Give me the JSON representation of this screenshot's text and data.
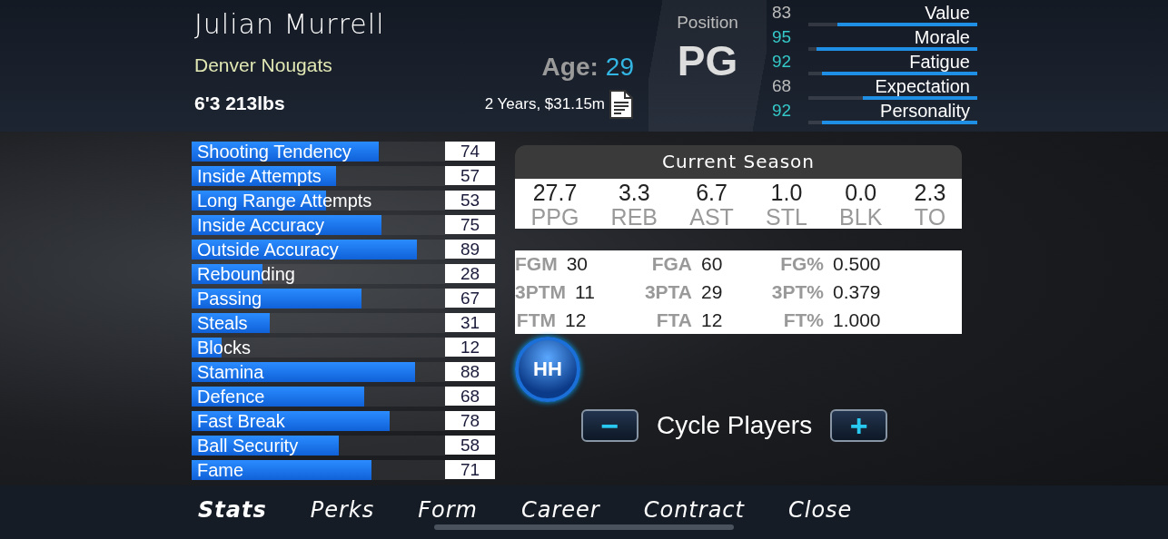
{
  "player": {
    "name": "Julian Murrell",
    "team": "Denver Nougats",
    "body": "6'3  213lbs",
    "age_label": "Age:",
    "age": "29",
    "contract": "2 Years, $31.15m",
    "position_label": "Position",
    "position": "PG"
  },
  "meters": [
    {
      "value": "83",
      "label": "Value",
      "level": 0.83,
      "highlight": false
    },
    {
      "value": "95",
      "label": "Morale",
      "level": 0.95,
      "highlight": true
    },
    {
      "value": "92",
      "label": "Fatigue",
      "level": 0.92,
      "highlight": true
    },
    {
      "value": "68",
      "label": "Expectation",
      "level": 0.68,
      "highlight": false
    },
    {
      "value": "92",
      "label": "Personality",
      "level": 0.92,
      "highlight": true
    }
  ],
  "attributes": [
    {
      "label": "Shooting Tendency",
      "value": "74",
      "level": 0.74
    },
    {
      "label": "Inside Attempts",
      "value": "57",
      "level": 0.57
    },
    {
      "label": "Long Range Attempts",
      "value": "53",
      "level": 0.53
    },
    {
      "label": "Inside Accuracy",
      "value": "75",
      "level": 0.75
    },
    {
      "label": "Outside Accuracy",
      "value": "89",
      "level": 0.89
    },
    {
      "label": "Rebounding",
      "value": "28",
      "level": 0.28
    },
    {
      "label": "Passing",
      "value": "67",
      "level": 0.67
    },
    {
      "label": "Steals",
      "value": "31",
      "level": 0.31
    },
    {
      "label": "Blocks",
      "value": "12",
      "level": 0.12
    },
    {
      "label": "Stamina",
      "value": "88",
      "level": 0.88
    },
    {
      "label": "Defence",
      "value": "68",
      "level": 0.68
    },
    {
      "label": "Fast Break",
      "value": "78",
      "level": 0.78
    },
    {
      "label": "Ball Security",
      "value": "58",
      "level": 0.58
    },
    {
      "label": "Fame",
      "value": "71",
      "level": 0.71
    }
  ],
  "season": {
    "title": "Current Season",
    "averages": [
      {
        "value": "27.7",
        "label": "PPG"
      },
      {
        "value": "3.3",
        "label": "REB"
      },
      {
        "value": "6.7",
        "label": "AST"
      },
      {
        "value": "1.0",
        "label": "STL"
      },
      {
        "value": "0.0",
        "label": "BLK"
      },
      {
        "value": "2.3",
        "label": "TO"
      }
    ],
    "shooting": [
      {
        "label": "FGM",
        "value": "30"
      },
      {
        "label": "FGA",
        "value": "60"
      },
      {
        "label": "FG%",
        "value": "0.500"
      },
      {
        "label": "3PTM",
        "value": "11"
      },
      {
        "label": "3PTA",
        "value": "29"
      },
      {
        "label": "3PT%",
        "value": "0.379"
      },
      {
        "label": "FTM",
        "value": "12"
      },
      {
        "label": "FTA",
        "value": "12"
      },
      {
        "label": "FT%",
        "value": "1.000"
      }
    ]
  },
  "hh_button": "HH",
  "cycle": {
    "minus": "−",
    "label": "Cycle Players",
    "plus": "+"
  },
  "tabs": [
    {
      "label": "Stats",
      "selected": true
    },
    {
      "label": "Perks",
      "selected": false
    },
    {
      "label": "Form",
      "selected": false
    },
    {
      "label": "Career",
      "selected": false
    },
    {
      "label": "Contract",
      "selected": false
    },
    {
      "label": "Close",
      "selected": false
    }
  ]
}
